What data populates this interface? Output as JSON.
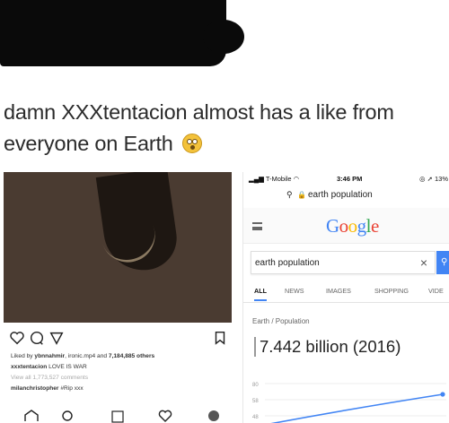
{
  "tweet": {
    "text": "damn XXXtentacion almost has a like from everyone on Earth",
    "emoji": "flushed-face"
  },
  "instagram": {
    "likes_prefix": "Liked by",
    "likes_user": "ybnnahmir",
    "likes_mid": ", ironic.mp4 and",
    "likes_count": "7,184,885 others",
    "caption_user": "xxxtentacion",
    "caption_text": "LOVE IS WAR",
    "view_comments": "View all 1,773,527 comments",
    "comment_user": "milanchristopher",
    "comment_text": "#Rip xxx"
  },
  "phone": {
    "carrier": "T-Mobile",
    "time": "3:46 PM",
    "battery": "13%",
    "url": "earth population",
    "logo": "Google",
    "query": "earth population",
    "clear_glyph": "×",
    "tabs": [
      "ALL",
      "NEWS",
      "IMAGES",
      "SHOPPING",
      "VIDE"
    ],
    "breadcrumb": "Earth / Population",
    "result": "7.442 billion (2016)"
  },
  "chart_data": {
    "type": "line",
    "yticks": [
      "80",
      "58",
      "48"
    ],
    "x": [
      0,
      1
    ],
    "values": [
      58,
      80
    ],
    "ylim": [
      48,
      80
    ],
    "color": "#4285f4"
  }
}
